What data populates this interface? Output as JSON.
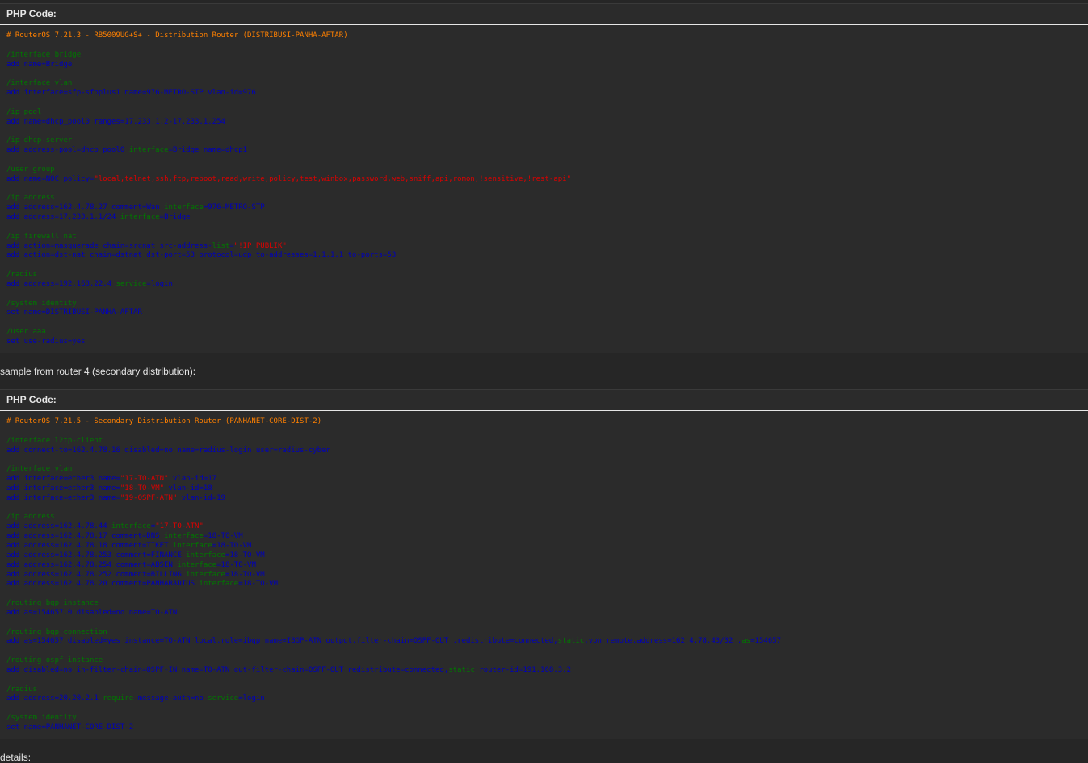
{
  "block1": {
    "header": "PHP Code:",
    "lines": [
      [
        {
          "t": "# RouterOS 7.21.3 - RB5009UG+S+ - Distribution Router (DISTRIBUSI-PANHA-AFTAR)",
          "c": "comment"
        }
      ],
      [],
      [
        {
          "t": "/interface bridge",
          "c": "path"
        }
      ],
      [
        {
          "t": "add name=Bridge",
          "c": "cmd"
        }
      ],
      [],
      [
        {
          "t": "/interface vlan",
          "c": "path"
        }
      ],
      [
        {
          "t": "add interface=sfp-sfpplus1 name=976-METRO-STP vlan-id=976",
          "c": "cmd"
        }
      ],
      [],
      [
        {
          "t": "/ip pool",
          "c": "path"
        }
      ],
      [
        {
          "t": "add name=dhcp_pool0 ranges=17.233.1.2-17.233.1.254",
          "c": "cmd"
        }
      ],
      [],
      [
        {
          "t": "/ip dhcp-server",
          "c": "path"
        }
      ],
      [
        {
          "t": "add address-pool=dhcp_pool0 ",
          "c": "cmd"
        },
        {
          "t": "interface",
          "c": "path"
        },
        {
          "t": "=Bridge name=dhcp1",
          "c": "cmd"
        }
      ],
      [],
      [
        {
          "t": "/user group",
          "c": "path"
        }
      ],
      [
        {
          "t": "add name=NOC policy=",
          "c": "cmd"
        },
        {
          "t": "\"local,telnet,ssh,ftp,reboot,read,write,policy,test,winbox,password,web,sniff,api,romon,!sensitive,!rest-api\"",
          "c": "str"
        }
      ],
      [],
      [
        {
          "t": "/ip address",
          "c": "path"
        }
      ],
      [
        {
          "t": "add address=162.4.78.27 comment=Wan ",
          "c": "cmd"
        },
        {
          "t": "interface",
          "c": "path"
        },
        {
          "t": "=976-METRO-STP",
          "c": "cmd"
        }
      ],
      [
        {
          "t": "add address=17.233.1.1/24 ",
          "c": "cmd"
        },
        {
          "t": "interface",
          "c": "path"
        },
        {
          "t": "=Bridge",
          "c": "cmd"
        }
      ],
      [],
      [
        {
          "t": "/ip firewall nat",
          "c": "path"
        }
      ],
      [
        {
          "t": "add action=masquerade chain=srcnat src-address-",
          "c": "cmd"
        },
        {
          "t": "list",
          "c": "path"
        },
        {
          "t": "=",
          "c": "cmd"
        },
        {
          "t": "\"!IP PUBLIK\"",
          "c": "str"
        }
      ],
      [
        {
          "t": "add action=dst-nat chain=dstnat dst-port=53 protocol=udp to-addresses=1.1.1.1 to-ports=53",
          "c": "cmd"
        }
      ],
      [],
      [
        {
          "t": "/radius",
          "c": "path"
        }
      ],
      [
        {
          "t": "add address=192.168.22.4 ",
          "c": "cmd"
        },
        {
          "t": "service",
          "c": "path"
        },
        {
          "t": "=login",
          "c": "cmd"
        }
      ],
      [],
      [
        {
          "t": "/system identity",
          "c": "path"
        }
      ],
      [
        {
          "t": "set name=DISTRIBUSI-PANHA-AFTAR",
          "c": "cmd"
        }
      ],
      [],
      [
        {
          "t": "/user aaa",
          "c": "path"
        }
      ],
      [
        {
          "t": "set use-radius=yes",
          "c": "cmd"
        }
      ]
    ]
  },
  "between_text": "sample from router 4 (secondary distribution):",
  "block2": {
    "header": "PHP Code:",
    "lines": [
      [
        {
          "t": "# RouterOS 7.21.5 - Secondary Distribution Router (PANHANET-CORE-DIST-2)",
          "c": "comment"
        }
      ],
      [],
      [
        {
          "t": "/interface l2tp-client",
          "c": "path"
        }
      ],
      [
        {
          "t": "add connect-to=162.4.78.16 disabled=no name=radius-login user=radius-cyber",
          "c": "cmd"
        }
      ],
      [],
      [
        {
          "t": "/interface vlan",
          "c": "path"
        }
      ],
      [
        {
          "t": "add interface=ether3 name=",
          "c": "cmd"
        },
        {
          "t": "\"17-TO-ATN\"",
          "c": "str"
        },
        {
          "t": " vlan-id=17",
          "c": "cmd"
        }
      ],
      [
        {
          "t": "add interface=ether3 name=",
          "c": "cmd"
        },
        {
          "t": "\"18-TO-VM\"",
          "c": "str"
        },
        {
          "t": " vlan-id=18",
          "c": "cmd"
        }
      ],
      [
        {
          "t": "add interface=ether3 name=",
          "c": "cmd"
        },
        {
          "t": "\"19-OSPF-ATN\"",
          "c": "str"
        },
        {
          "t": " vlan-id=19",
          "c": "cmd"
        }
      ],
      [],
      [
        {
          "t": "/ip address",
          "c": "path"
        }
      ],
      [
        {
          "t": "add address=162.4.78.44 ",
          "c": "cmd"
        },
        {
          "t": "interface",
          "c": "path"
        },
        {
          "t": "=",
          "c": "cmd"
        },
        {
          "t": "\"17-TO-ATN\"",
          "c": "str"
        }
      ],
      [
        {
          "t": "add address=162.4.78.17 comment=DNS ",
          "c": "cmd"
        },
        {
          "t": "interface",
          "c": "path"
        },
        {
          "t": "=18-TO-VM",
          "c": "cmd"
        }
      ],
      [
        {
          "t": "add address=162.4.78.18 comment=TIKET ",
          "c": "cmd"
        },
        {
          "t": "interface",
          "c": "path"
        },
        {
          "t": "=18-TO-VM",
          "c": "cmd"
        }
      ],
      [
        {
          "t": "add address=162.4.78.253 comment=FINANCE ",
          "c": "cmd"
        },
        {
          "t": "interface",
          "c": "path"
        },
        {
          "t": "=18-TO-VM",
          "c": "cmd"
        }
      ],
      [
        {
          "t": "add address=162.4.78.254 comment=ABSEN ",
          "c": "cmd"
        },
        {
          "t": "interface",
          "c": "path"
        },
        {
          "t": "=18-TO-VM",
          "c": "cmd"
        }
      ],
      [
        {
          "t": "add address=162.4.78.252 comment=BILLING ",
          "c": "cmd"
        },
        {
          "t": "interface",
          "c": "path"
        },
        {
          "t": "=18-TO-VM",
          "c": "cmd"
        }
      ],
      [
        {
          "t": "add address=162.4.78.20 comment=PANHARADIUS ",
          "c": "cmd"
        },
        {
          "t": "interface",
          "c": "path"
        },
        {
          "t": "=18-TO-VM",
          "c": "cmd"
        }
      ],
      [],
      [
        {
          "t": "/routing bgp instance",
          "c": "path"
        }
      ],
      [
        {
          "t": "add as=154657.0 disabled=no name=TO-ATN",
          "c": "cmd"
        }
      ],
      [],
      [
        {
          "t": "/routing bgp connection",
          "c": "path"
        }
      ],
      [
        {
          "t": "add as=154657 disabled=yes instance=TO-ATN local.role=ibgp name=IBGP-ATN output.filter-chain=OSPF-OUT .redistribute=connected,",
          "c": "cmd"
        },
        {
          "t": "static",
          "c": "path"
        },
        {
          "t": ",vpn remote.address=162.4.78.43/32 .",
          "c": "cmd"
        },
        {
          "t": "as",
          "c": "path"
        },
        {
          "t": "=154657",
          "c": "cmd"
        }
      ],
      [],
      [
        {
          "t": "/routing ospf instance",
          "c": "path"
        }
      ],
      [
        {
          "t": "add disabled=no in-filter-chain=OSPF-IN name=TO-ATN out-filter-chain=OSPF-OUT redistribute=connected,",
          "c": "cmd"
        },
        {
          "t": "static",
          "c": "path"
        },
        {
          "t": " router-id=191.168.3.2",
          "c": "cmd"
        }
      ],
      [],
      [
        {
          "t": "/radius",
          "c": "path"
        }
      ],
      [
        {
          "t": "add address=20.20.2.1 ",
          "c": "cmd"
        },
        {
          "t": "require",
          "c": "path"
        },
        {
          "t": "-message-auth=no ",
          "c": "cmd"
        },
        {
          "t": "service",
          "c": "path"
        },
        {
          "t": "=login",
          "c": "cmd"
        }
      ],
      [],
      [
        {
          "t": "/system identity",
          "c": "path"
        }
      ],
      [
        {
          "t": "set name=PANHANET-CORE-DIST-2",
          "c": "cmd"
        }
      ]
    ]
  },
  "footer_text": "details:"
}
